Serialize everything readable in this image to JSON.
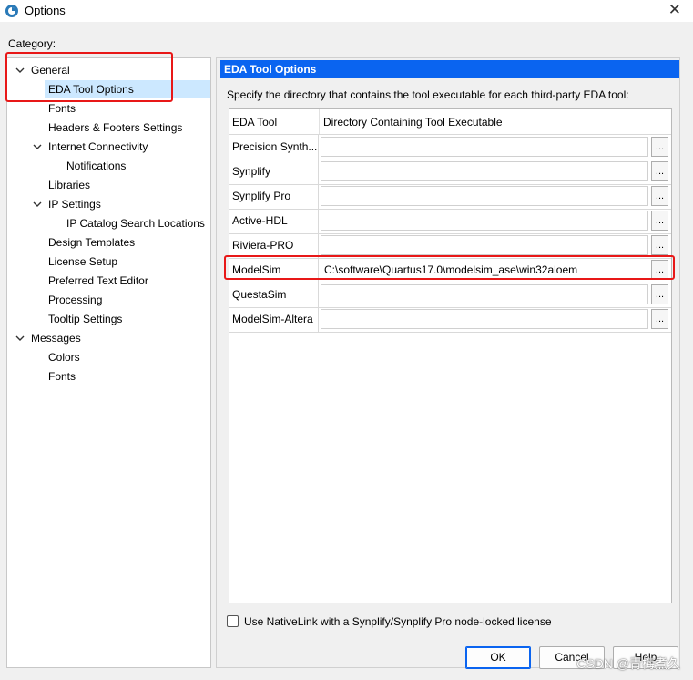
{
  "window": {
    "title": "Options",
    "close_icon": "close-icon",
    "app_icon": "quartus-app-icon"
  },
  "category_label": "Category:",
  "tree": {
    "items": [
      {
        "label": "General",
        "expanded": true
      },
      {
        "label": "EDA Tool Options",
        "selected": true
      },
      {
        "label": "Fonts"
      },
      {
        "label": "Headers & Footers Settings"
      },
      {
        "label": "Internet Connectivity",
        "expanded": true
      },
      {
        "label": "Notifications"
      },
      {
        "label": "Libraries"
      },
      {
        "label": "IP Settings",
        "expanded": true
      },
      {
        "label": "IP Catalog Search Locations"
      },
      {
        "label": "Design Templates"
      },
      {
        "label": "License Setup"
      },
      {
        "label": "Preferred Text Editor"
      },
      {
        "label": "Processing"
      },
      {
        "label": "Tooltip Settings"
      },
      {
        "label": "Messages",
        "expanded": true
      },
      {
        "label": "Colors"
      },
      {
        "label": "Fonts"
      }
    ]
  },
  "panel": {
    "header": "EDA Tool Options",
    "description": "Specify the directory that contains the tool executable for each third-party EDA tool:",
    "columns": {
      "tool": "EDA Tool",
      "directory": "Directory Containing Tool Executable"
    },
    "rows": [
      {
        "tool": "Precision Synth...",
        "path": "",
        "browse": "..."
      },
      {
        "tool": "Synplify",
        "path": "",
        "browse": "..."
      },
      {
        "tool": "Synplify Pro",
        "path": "",
        "browse": "..."
      },
      {
        "tool": "Active-HDL",
        "path": "",
        "browse": "..."
      },
      {
        "tool": "Riviera-PRO",
        "path": "",
        "browse": "..."
      },
      {
        "tool": "ModelSim",
        "path": "C:\\software\\Quartus17.0\\modelsim_ase\\win32aloem",
        "browse": "..."
      },
      {
        "tool": "QuestaSim",
        "path": "",
        "browse": "..."
      },
      {
        "tool": "ModelSim-Altera",
        "path": "",
        "browse": "..."
      }
    ],
    "checkbox_label": "Use NativeLink with a Synplify/Synplify Pro node-locked license",
    "checkbox_checked": false
  },
  "buttons": {
    "ok": "OK",
    "cancel": "Cancel",
    "help": "Help"
  },
  "watermark": "CSDN @青梅煮久",
  "colors": {
    "accent": "#0a64f0",
    "selection": "#cce8ff",
    "highlight_box": "#e81818"
  }
}
